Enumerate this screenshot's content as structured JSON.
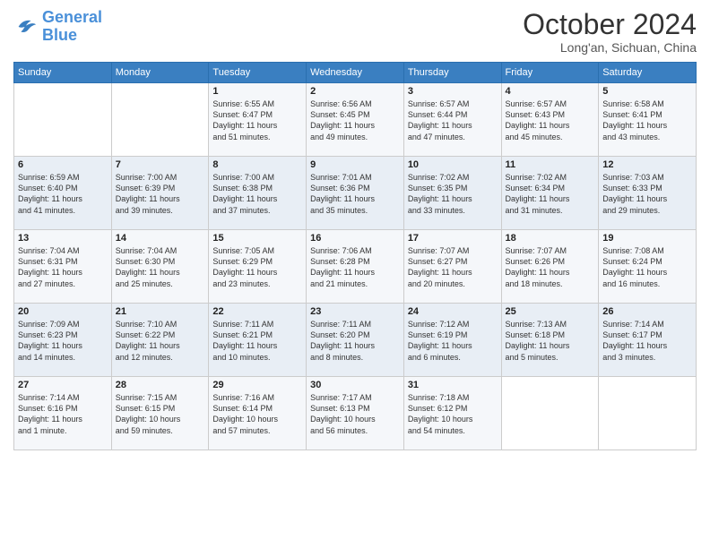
{
  "logo": {
    "line1": "General",
    "line2": "Blue"
  },
  "title": "October 2024",
  "location": "Long'an, Sichuan, China",
  "weekdays": [
    "Sunday",
    "Monday",
    "Tuesday",
    "Wednesday",
    "Thursday",
    "Friday",
    "Saturday"
  ],
  "weeks": [
    [
      {
        "day": "",
        "detail": ""
      },
      {
        "day": "",
        "detail": ""
      },
      {
        "day": "1",
        "detail": "Sunrise: 6:55 AM\nSunset: 6:47 PM\nDaylight: 11 hours\nand 51 minutes."
      },
      {
        "day": "2",
        "detail": "Sunrise: 6:56 AM\nSunset: 6:45 PM\nDaylight: 11 hours\nand 49 minutes."
      },
      {
        "day": "3",
        "detail": "Sunrise: 6:57 AM\nSunset: 6:44 PM\nDaylight: 11 hours\nand 47 minutes."
      },
      {
        "day": "4",
        "detail": "Sunrise: 6:57 AM\nSunset: 6:43 PM\nDaylight: 11 hours\nand 45 minutes."
      },
      {
        "day": "5",
        "detail": "Sunrise: 6:58 AM\nSunset: 6:41 PM\nDaylight: 11 hours\nand 43 minutes."
      }
    ],
    [
      {
        "day": "6",
        "detail": "Sunrise: 6:59 AM\nSunset: 6:40 PM\nDaylight: 11 hours\nand 41 minutes."
      },
      {
        "day": "7",
        "detail": "Sunrise: 7:00 AM\nSunset: 6:39 PM\nDaylight: 11 hours\nand 39 minutes."
      },
      {
        "day": "8",
        "detail": "Sunrise: 7:00 AM\nSunset: 6:38 PM\nDaylight: 11 hours\nand 37 minutes."
      },
      {
        "day": "9",
        "detail": "Sunrise: 7:01 AM\nSunset: 6:36 PM\nDaylight: 11 hours\nand 35 minutes."
      },
      {
        "day": "10",
        "detail": "Sunrise: 7:02 AM\nSunset: 6:35 PM\nDaylight: 11 hours\nand 33 minutes."
      },
      {
        "day": "11",
        "detail": "Sunrise: 7:02 AM\nSunset: 6:34 PM\nDaylight: 11 hours\nand 31 minutes."
      },
      {
        "day": "12",
        "detail": "Sunrise: 7:03 AM\nSunset: 6:33 PM\nDaylight: 11 hours\nand 29 minutes."
      }
    ],
    [
      {
        "day": "13",
        "detail": "Sunrise: 7:04 AM\nSunset: 6:31 PM\nDaylight: 11 hours\nand 27 minutes."
      },
      {
        "day": "14",
        "detail": "Sunrise: 7:04 AM\nSunset: 6:30 PM\nDaylight: 11 hours\nand 25 minutes."
      },
      {
        "day": "15",
        "detail": "Sunrise: 7:05 AM\nSunset: 6:29 PM\nDaylight: 11 hours\nand 23 minutes."
      },
      {
        "day": "16",
        "detail": "Sunrise: 7:06 AM\nSunset: 6:28 PM\nDaylight: 11 hours\nand 21 minutes."
      },
      {
        "day": "17",
        "detail": "Sunrise: 7:07 AM\nSunset: 6:27 PM\nDaylight: 11 hours\nand 20 minutes."
      },
      {
        "day": "18",
        "detail": "Sunrise: 7:07 AM\nSunset: 6:26 PM\nDaylight: 11 hours\nand 18 minutes."
      },
      {
        "day": "19",
        "detail": "Sunrise: 7:08 AM\nSunset: 6:24 PM\nDaylight: 11 hours\nand 16 minutes."
      }
    ],
    [
      {
        "day": "20",
        "detail": "Sunrise: 7:09 AM\nSunset: 6:23 PM\nDaylight: 11 hours\nand 14 minutes."
      },
      {
        "day": "21",
        "detail": "Sunrise: 7:10 AM\nSunset: 6:22 PM\nDaylight: 11 hours\nand 12 minutes."
      },
      {
        "day": "22",
        "detail": "Sunrise: 7:11 AM\nSunset: 6:21 PM\nDaylight: 11 hours\nand 10 minutes."
      },
      {
        "day": "23",
        "detail": "Sunrise: 7:11 AM\nSunset: 6:20 PM\nDaylight: 11 hours\nand 8 minutes."
      },
      {
        "day": "24",
        "detail": "Sunrise: 7:12 AM\nSunset: 6:19 PM\nDaylight: 11 hours\nand 6 minutes."
      },
      {
        "day": "25",
        "detail": "Sunrise: 7:13 AM\nSunset: 6:18 PM\nDaylight: 11 hours\nand 5 minutes."
      },
      {
        "day": "26",
        "detail": "Sunrise: 7:14 AM\nSunset: 6:17 PM\nDaylight: 11 hours\nand 3 minutes."
      }
    ],
    [
      {
        "day": "27",
        "detail": "Sunrise: 7:14 AM\nSunset: 6:16 PM\nDaylight: 11 hours\nand 1 minute."
      },
      {
        "day": "28",
        "detail": "Sunrise: 7:15 AM\nSunset: 6:15 PM\nDaylight: 10 hours\nand 59 minutes."
      },
      {
        "day": "29",
        "detail": "Sunrise: 7:16 AM\nSunset: 6:14 PM\nDaylight: 10 hours\nand 57 minutes."
      },
      {
        "day": "30",
        "detail": "Sunrise: 7:17 AM\nSunset: 6:13 PM\nDaylight: 10 hours\nand 56 minutes."
      },
      {
        "day": "31",
        "detail": "Sunrise: 7:18 AM\nSunset: 6:12 PM\nDaylight: 10 hours\nand 54 minutes."
      },
      {
        "day": "",
        "detail": ""
      },
      {
        "day": "",
        "detail": ""
      }
    ]
  ]
}
